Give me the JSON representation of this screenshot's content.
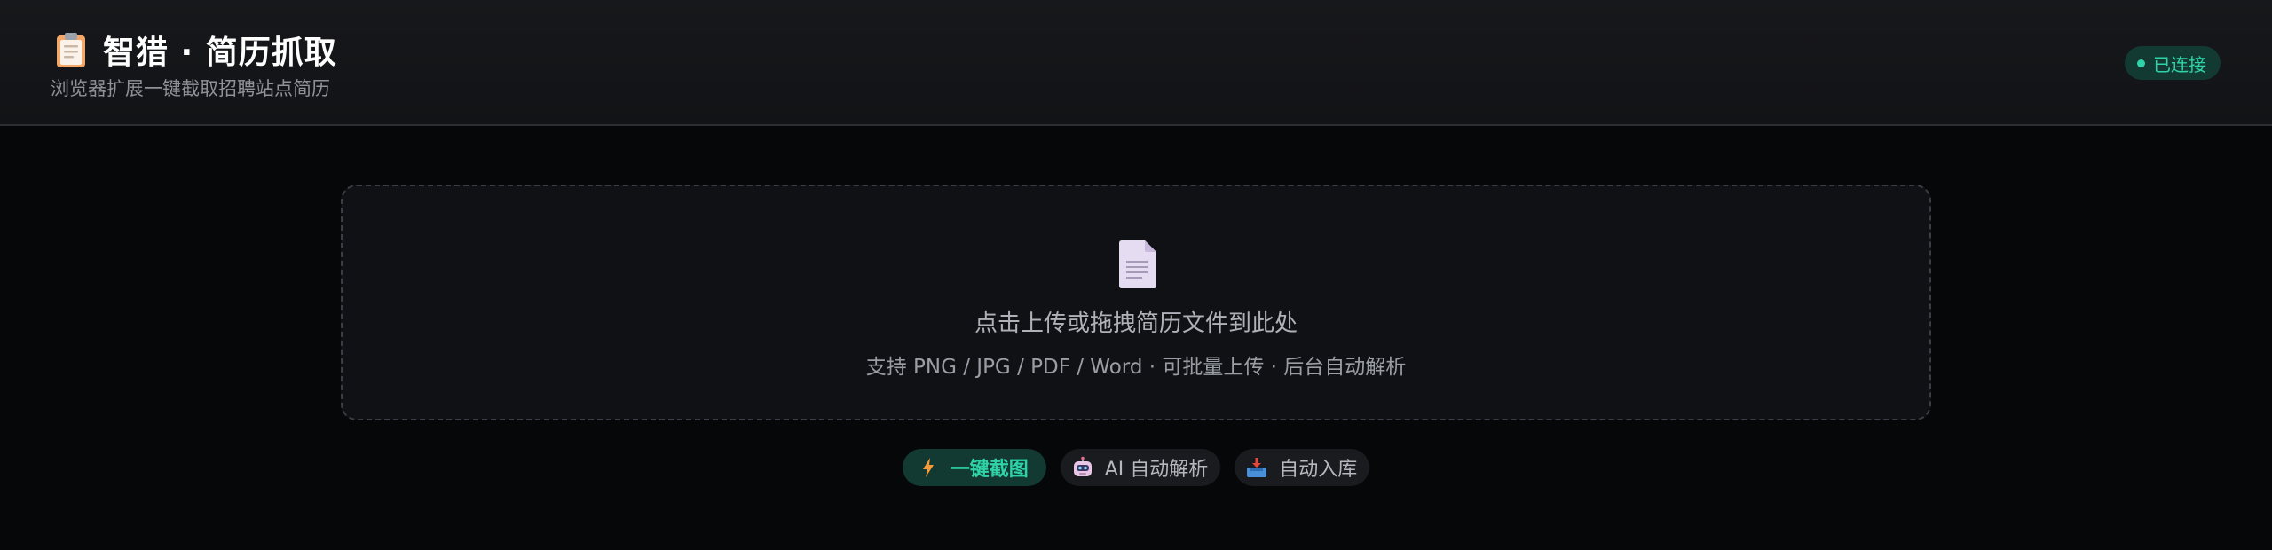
{
  "header": {
    "title": "智猎 · 简历抓取",
    "subtitle": "浏览器扩展一键截取招聘站点简历",
    "icon": "clipboard-icon",
    "status": {
      "label": "已连接",
      "color": "#2fd3a8"
    }
  },
  "upload": {
    "icon": "document-icon",
    "title": "点击上传或拖拽简历文件到此处",
    "hint": "支持 PNG / JPG / PDF / Word · 可批量上传 · 后台自动解析"
  },
  "features": [
    {
      "icon": "lightning-icon",
      "label": "一键截图",
      "active": true
    },
    {
      "icon": "robot-icon",
      "label": "AI 自动解析",
      "active": false
    },
    {
      "icon": "inbox-tray-icon",
      "label": "自动入库",
      "active": false
    }
  ],
  "colors": {
    "accent": "#2fd3a8",
    "background": "#060708",
    "panel": "#101114"
  }
}
